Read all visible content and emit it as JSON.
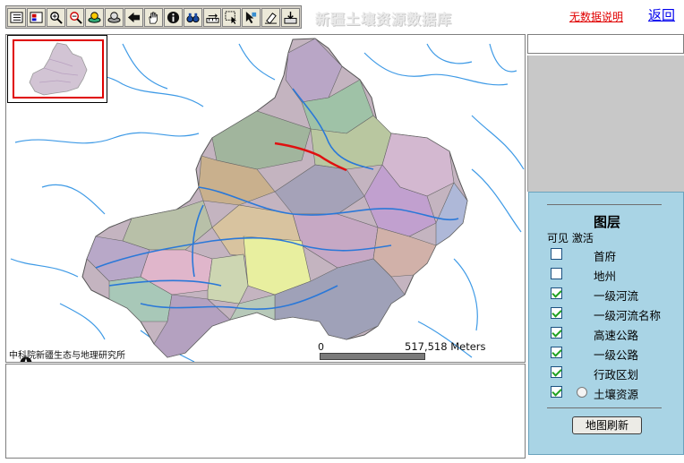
{
  "toolbar": {
    "tools": [
      {
        "name": "layer-list-icon"
      },
      {
        "name": "legend-icon"
      },
      {
        "name": "zoom-in-icon"
      },
      {
        "name": "zoom-out-icon"
      },
      {
        "name": "zoom-full-icon"
      },
      {
        "name": "zoom-last-icon"
      },
      {
        "name": "back-icon"
      },
      {
        "name": "pan-hand-icon"
      },
      {
        "name": "identify-icon"
      },
      {
        "name": "find-binoculars-icon"
      },
      {
        "name": "measure-icon"
      },
      {
        "name": "select-rect-icon"
      },
      {
        "name": "select-pointer-icon"
      },
      {
        "name": "clear-eraser-icon"
      },
      {
        "name": "print-download-icon"
      }
    ]
  },
  "header": {
    "ghost_title": "新疆土壤资源数据库",
    "no_data_link": "无数据说明",
    "back_link": "返回"
  },
  "map": {
    "credit": "中科院新疆生态与地理研究所",
    "scale_start": "0",
    "scale_end": "517,518 Meters"
  },
  "layers": {
    "title": "图层",
    "header": "可见 激活",
    "items": [
      {
        "label": "首府",
        "visible": false,
        "active_radio": false
      },
      {
        "label": "地州",
        "visible": false,
        "active_radio": false
      },
      {
        "label": "一级河流",
        "visible": true,
        "active_radio": false
      },
      {
        "label": "一级河流名称",
        "visible": true,
        "active_radio": false
      },
      {
        "label": "高速公路",
        "visible": true,
        "active_radio": false
      },
      {
        "label": "一级公路",
        "visible": true,
        "active_radio": false
      },
      {
        "label": "行政区划",
        "visible": true,
        "active_radio": false
      },
      {
        "label": "土壤资源",
        "visible": true,
        "active_radio": true
      }
    ],
    "refresh_button": "地图刷新"
  }
}
